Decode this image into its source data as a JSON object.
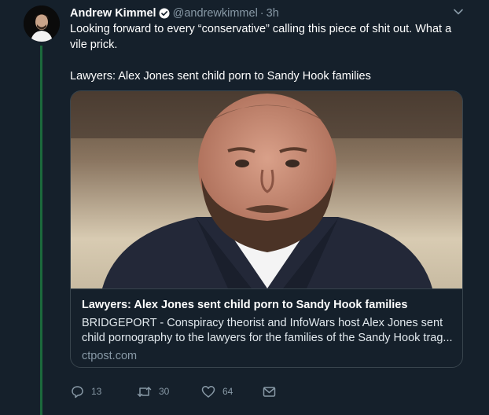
{
  "tweet": {
    "author_name": "Andrew Kimmel",
    "handle": "@andrewkimmel",
    "separator": "·",
    "time": "3h",
    "text_line1": "Looking forward to every “conservative” calling this piece of shit out. What a vile prick.",
    "text_line2": "Lawyers: Alex Jones sent child porn to Sandy Hook families"
  },
  "card": {
    "title": "Lawyers: Alex Jones sent child porn to Sandy Hook families",
    "description": "BRIDGEPORT - Conspiracy theorist and InfoWars host Alex Jones sent child pornography to the lawyers for the families of the Sandy Hook trag...",
    "domain": "ctpost.com"
  },
  "actions": {
    "replies": "13",
    "retweets": "30",
    "likes": "64"
  },
  "icons": {
    "verified": "verified-badge-icon",
    "menu": "chevron-down-icon",
    "reply": "reply-icon",
    "retweet": "retweet-icon",
    "like": "heart-icon",
    "dm": "envelope-icon"
  },
  "colors": {
    "background": "#15202b",
    "secondary_text": "#8899a6",
    "border": "#38444d",
    "thread_line": "#1c6a3c"
  }
}
